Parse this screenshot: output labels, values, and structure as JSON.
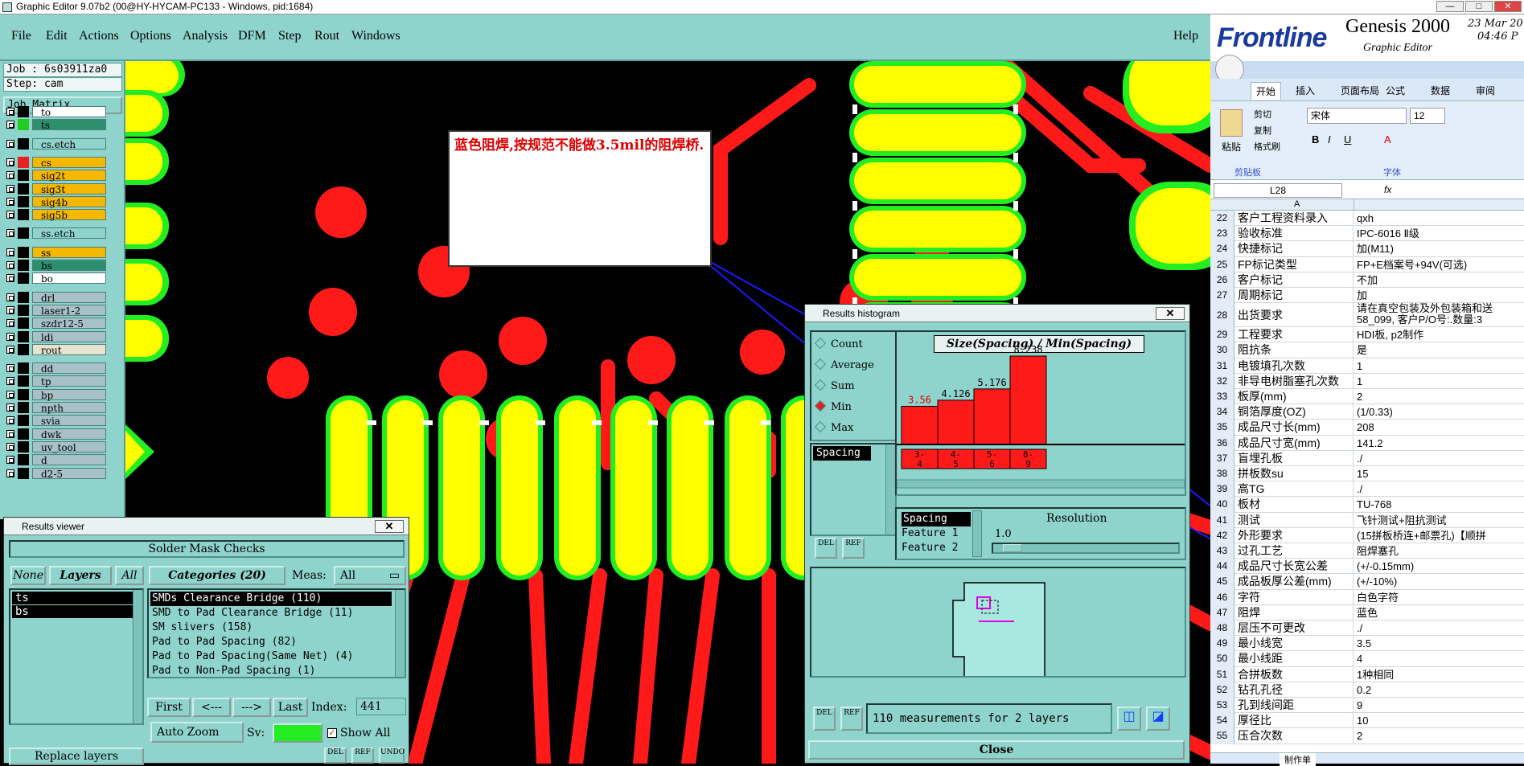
{
  "window": {
    "title": "Graphic Editor 9.07b2 (00@HY-HYCAM-PC133 - Windows, pid:1684)",
    "buttons": [
      "—",
      "□",
      "✕"
    ]
  },
  "menu": {
    "items": [
      "File",
      "Edit",
      "Actions",
      "Options",
      "Analysis",
      "DFM",
      "Step",
      "Rout",
      "Windows"
    ],
    "help": "Help"
  },
  "left": {
    "job": "Job : 6s03911za0",
    "step": "Step: cam",
    "matrix": "Job Matrix ...",
    "layers": [
      {
        "name": "to",
        "color": "#ffffff",
        "sw": "#000"
      },
      {
        "name": "ts",
        "color": "#2e8f6e",
        "sw": "#22cc22"
      },
      {
        "name": "cs.etch",
        "color": "#8fd4cc",
        "sw": "#000"
      },
      {
        "name": "cs",
        "color": "#f5b800",
        "sw": "#e82020"
      },
      {
        "name": "sig2t",
        "color": "#f5b800",
        "sw": "#000"
      },
      {
        "name": "sig3t",
        "color": "#f5b800",
        "sw": "#000"
      },
      {
        "name": "sig4b",
        "color": "#f5b800",
        "sw": "#000"
      },
      {
        "name": "sig5b",
        "color": "#f5b800",
        "sw": "#000"
      },
      {
        "name": "ss.etch",
        "color": "#8fd4cc",
        "sw": "#000"
      },
      {
        "name": "ss",
        "color": "#f5b800",
        "sw": "#000"
      },
      {
        "name": "bs",
        "color": "#2e8f6e",
        "sw": "#000"
      },
      {
        "name": "bo",
        "color": "#ffffff",
        "sw": "#000"
      },
      {
        "name": "drl",
        "color": "#a8c0c8",
        "sw": "#000"
      },
      {
        "name": "laser1-2",
        "color": "#a8c0c8",
        "sw": "#000"
      },
      {
        "name": "szdr12-5",
        "color": "#a8c0c8",
        "sw": "#000"
      },
      {
        "name": "ldi",
        "color": "#a8c0c8",
        "sw": "#000"
      },
      {
        "name": "rout",
        "color": "#e8e2d0",
        "sw": "#000"
      },
      {
        "name": "dd",
        "color": "#a8c0c8",
        "sw": "#000"
      },
      {
        "name": "tp",
        "color": "#a8c0c8",
        "sw": "#000"
      },
      {
        "name": "bp",
        "color": "#a8c0c8",
        "sw": "#000"
      },
      {
        "name": "npth",
        "color": "#a8c0c8",
        "sw": "#000"
      },
      {
        "name": "svia",
        "color": "#a8c0c8",
        "sw": "#000"
      },
      {
        "name": "dwk",
        "color": "#a8c0c8",
        "sw": "#000"
      },
      {
        "name": "uv_tool",
        "color": "#a8c0c8",
        "sw": "#000"
      },
      {
        "name": "d",
        "color": "#a8c0c8",
        "sw": "#000"
      },
      {
        "name": "d2-5",
        "color": "#a8c0c8",
        "sw": "#000"
      }
    ]
  },
  "note": {
    "text": "蓝色阻焊,按规范不能做3.5mil的阻焊桥."
  },
  "viewer": {
    "title": "Results viewer",
    "header": "Solder Mask Checks",
    "none": "None",
    "layers_btn": "Layers",
    "all": "All",
    "categories": "Categories (20)",
    "meas_label": "Meas:",
    "meas_value": "All",
    "layer_list": [
      "ts",
      "bs"
    ],
    "checks": [
      "SMDs Clearance Bridge (110)",
      "SMD to Pad Clearance Bridge (11)",
      "SM slivers (158)",
      "Pad to Pad Spacing (82)",
      "Pad to Pad Spacing(Same Net) (4)",
      "Pad to Non-Pad Spacing (1)"
    ],
    "nav": {
      "first": "First",
      "prev": "<---",
      "next": "--->",
      "last": "Last",
      "index_label": "Index:",
      "index_value": "441"
    },
    "auto_zoom": "Auto Zoom",
    "sv": "Sv:",
    "show_all": "Show All",
    "replace": "Replace layers",
    "del": "DEL",
    "ref": "REF",
    "undo": "UNDO"
  },
  "histogram": {
    "title": "Results histogram",
    "options": [
      "Count",
      "Average",
      "Sum",
      "Min",
      "Max"
    ],
    "selected": "Min",
    "list_item": "Spacing",
    "chart_title": "Size(Spacing) / Min(Spacing)",
    "bins": [
      "3-4",
      "4-5",
      "5-6",
      "8-9"
    ],
    "values": [
      3.56,
      4.126,
      5.176,
      8.238
    ],
    "legend": {
      "spacing": "Spacing",
      "f1": "Feature 1",
      "f2": "Feature 2"
    },
    "resolution": "Resolution",
    "res_value": "1.0",
    "status": "110 measurements for 2 layers",
    "close": "Close",
    "del": "DEL",
    "ref": "REF"
  },
  "brand": {
    "logo": "Frontline",
    "product": "Genesis 2000",
    "sub": "Graphic Editor",
    "date": "23 Mar 20",
    "time": "04:46 P"
  },
  "excel": {
    "tabs": [
      "开始",
      "插入",
      "页面布局",
      "公式",
      "数据",
      "审阅"
    ],
    "clipboard": {
      "paste": "粘贴",
      "cut": "剪切",
      "copy": "复制",
      "format": "格式刷",
      "group": "剪贴板"
    },
    "font": {
      "name": "宋体",
      "size": "12",
      "group": "字体"
    },
    "cellref": "L28",
    "fx": "fx",
    "col_a": "A",
    "rows": [
      [
        "22",
        "客户工程资料录入",
        "qxh"
      ],
      [
        "23",
        "验收标准",
        "IPC-6016 Ⅱ级"
      ],
      [
        "24",
        "快捷标记",
        "加(M11)"
      ],
      [
        "25",
        "FP标记类型",
        "FP+E档案号+94V(可选)"
      ],
      [
        "26",
        "客户标记",
        "不加"
      ],
      [
        "27",
        "周期标记",
        "加"
      ],
      [
        "28",
        "出货要求",
        "请在真空包装及外包装箱和送 58_099, 客户P/O号:.数量:3"
      ],
      [
        "29",
        "工程要求",
        "HDI板, p2制作"
      ],
      [
        "30",
        "阻抗条",
        "是"
      ],
      [
        "31",
        "电镀填孔次数",
        "1"
      ],
      [
        "32",
        "非导电树脂塞孔次数",
        "1"
      ],
      [
        "33",
        "板厚(mm)",
        "2"
      ],
      [
        "34",
        "铜箔厚度(OZ)",
        "(1/0.33)"
      ],
      [
        "35",
        "成品尺寸长(mm)",
        "208"
      ],
      [
        "36",
        "成品尺寸宽(mm)",
        "141.2"
      ],
      [
        "37",
        "盲埋孔板",
        "./"
      ],
      [
        "38",
        "拼板数su",
        "15"
      ],
      [
        "39",
        "高TG",
        "./"
      ],
      [
        "40",
        "板材",
        "TU-768"
      ],
      [
        "41",
        "测试",
        "飞针测试+阻抗测试"
      ],
      [
        "42",
        "外形要求",
        "(15拼板桥连+邮票孔)【顺拼"
      ],
      [
        "43",
        "过孔工艺",
        "阻焊塞孔"
      ],
      [
        "44",
        "成品尺寸长宽公差",
        "(+/-0.15mm)"
      ],
      [
        "45",
        "成品板厚公差(mm)",
        "(+/-10%)"
      ],
      [
        "46",
        "字符",
        "白色字符"
      ],
      [
        "47",
        "阻焊",
        "蓝色"
      ],
      [
        "48",
        "层压不可更改",
        "./"
      ],
      [
        "49",
        "最小线宽",
        "3.5"
      ],
      [
        "50",
        "最小线距",
        "4"
      ],
      [
        "51",
        "合拼板数",
        "1种相同"
      ],
      [
        "52",
        "钻孔孔径",
        "0.2"
      ],
      [
        "53",
        "孔到线间距",
        "9"
      ],
      [
        "54",
        "厚径比",
        "10"
      ],
      [
        "55",
        "压合次数",
        "2"
      ]
    ],
    "sheet_tab": "制作单"
  }
}
